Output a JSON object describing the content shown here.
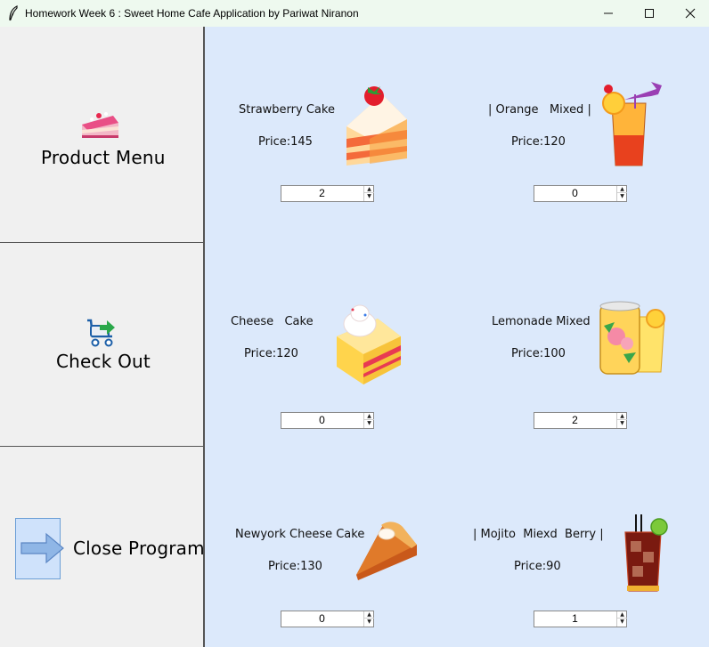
{
  "window": {
    "title": "Homework Week 6 : Sweet Home Cafe Application by Pariwat Niranon"
  },
  "sidebar": {
    "items": [
      {
        "label": "Product Menu",
        "icon": "cake-slice-icon"
      },
      {
        "label": "Check Out",
        "icon": "cart-arrow-icon"
      },
      {
        "label": "Close Program",
        "icon": "arrow-right-icon"
      }
    ]
  },
  "products": [
    {
      "name": "Strawberry Cake",
      "price": "Price:145",
      "quantity": "2",
      "icon": "strawberry-cake-icon"
    },
    {
      "name": "| Orange   Mixed |",
      "price": "Price:120",
      "quantity": "0",
      "icon": "orange-drink-icon"
    },
    {
      "name": "Cheese   Cake",
      "price": "Price:120",
      "quantity": "0",
      "icon": "cheese-cake-icon"
    },
    {
      "name": "Lemonade Mixed",
      "price": "Price:100",
      "quantity": "2",
      "icon": "lemonade-icon"
    },
    {
      "name": "Newyork Cheese Cake",
      "price": "Price:130",
      "quantity": "0",
      "icon": "pie-slice-icon"
    },
    {
      "name": "| Mojito  Miexd  Berry |",
      "price": "Price:90",
      "quantity": "1",
      "icon": "mojito-berry-icon"
    }
  ],
  "colors": {
    "titlebar": "#eef9ef",
    "sidebar": "#f0f0f0",
    "content": "#dce9fb"
  }
}
